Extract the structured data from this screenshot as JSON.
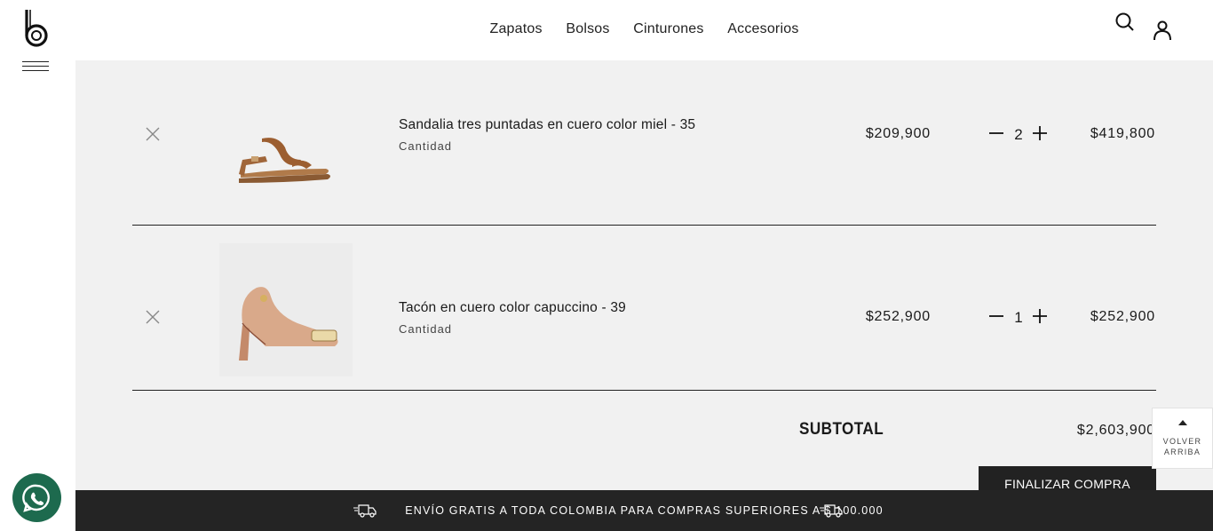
{
  "nav": {
    "items": [
      "Zapatos",
      "Bolsos",
      "Cinturones",
      "Accesorios"
    ]
  },
  "cart": {
    "rows": [
      {
        "name": "Sandalia tres puntadas en cuero color miel - 35",
        "qty_label": "Cantidad",
        "price": "$209,900",
        "qty": "2",
        "total": "$419,800"
      },
      {
        "name": "Tacón en cuero color capuccino - 39",
        "qty_label": "Cantidad",
        "price": "$252,900",
        "qty": "1",
        "total": "$252,900"
      }
    ],
    "subtotal_label": "SUBTOTAL",
    "subtotal_value": "$2,603,900",
    "checkout_label": "FINALIZAR COMPRA"
  },
  "banner": {
    "text": "ENVÍO GRATIS A TODA COLOMBIA PARA COMPRAS SUPERIORES A $ 100.000"
  },
  "back_to_top": {
    "line1": "VOLVER",
    "line2": "ARRIBA"
  },
  "colors": {
    "accent_dark": "#242424",
    "whatsapp": "#1d6a4e",
    "content_bg": "#f1f1f1"
  }
}
